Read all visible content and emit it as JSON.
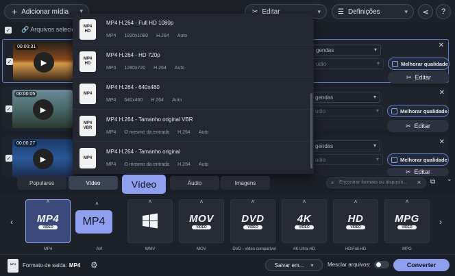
{
  "toolbar": {
    "add_media_label": "Adicionar mídia",
    "edit_label": "Editar",
    "settings_label": "Definições"
  },
  "selection": {
    "label": "Arquivos selecio"
  },
  "files": [
    {
      "duration": "00:00:31",
      "subtitles": "gendas",
      "audio": "udio",
      "enhance": "Melhorar qualidade",
      "edit": "Editar"
    },
    {
      "duration": "00:00:05",
      "subtitles": "gendas",
      "audio": "udio",
      "enhance": "Melhorar qualidade",
      "edit": "Editar"
    },
    {
      "duration": "00:00:27",
      "subtitles": "gendas",
      "audio": "udio",
      "enhance": "Melhorar qualidade",
      "edit": "Editar"
    }
  ],
  "dropdown": {
    "items": [
      {
        "icon_top": "MP4",
        "icon_bottom": "HD",
        "title": "MP4 H.264 - Full HD 1080p",
        "details": [
          "MP4",
          "1920x1080",
          "H.264",
          "Auto"
        ]
      },
      {
        "icon_top": "MP4",
        "icon_bottom": "HD",
        "title": "MP4 H.264 - HD 720p",
        "details": [
          "MP4",
          "1280x720",
          "H.264",
          "Auto"
        ]
      },
      {
        "icon_top": "MP4",
        "icon_bottom": "",
        "title": "MP4 H.264 - 640x480",
        "details": [
          "MP4",
          "640x480",
          "H.264",
          "Auto"
        ]
      },
      {
        "icon_top": "MP4",
        "icon_bottom": "VBR",
        "title": "MP4 H.264 - Tamanho original VBR",
        "details": [
          "MP4",
          "O mesmo da entrada",
          "H.264",
          "Auto"
        ]
      },
      {
        "icon_top": "MP4",
        "icon_bottom": "",
        "title": "MP4 H.264 - Tamanho original",
        "details": [
          "MP4",
          "O mesmo da entrada",
          "H.264",
          "Auto"
        ]
      }
    ]
  },
  "tabs": {
    "populares": "Populares",
    "video": "Vídeo",
    "video_tooltip": "Vídeo",
    "audio": "Áudio",
    "imagens": "Imagens"
  },
  "search": {
    "placeholder": "Encontrar formato ou dispositi..."
  },
  "formats": [
    {
      "logo": "MP4",
      "sub": "VIDEO",
      "label": "MP4"
    },
    {
      "logo": "",
      "sub": "",
      "label": "AVI"
    },
    {
      "logo": "",
      "sub": "",
      "label": "WMV"
    },
    {
      "logo": "MOV",
      "sub": "VIDEO",
      "label": "MOV"
    },
    {
      "logo": "DVD",
      "sub": "VIDEO",
      "label": "DVD - vídeo compatível"
    },
    {
      "logo": "4K",
      "sub": "VIDEO",
      "label": "4K Ultra HD"
    },
    {
      "logo": "HD",
      "sub": "VIDEO",
      "label": "HD/Full HD"
    },
    {
      "logo": "MPG",
      "sub": "VIDEO",
      "label": "MPG"
    }
  ],
  "format_tooltip": "MP4",
  "bottom": {
    "output_label": "Formato de saída:",
    "output_value": "MP4",
    "save_label": "Salvar em...",
    "merge_label": "Mesclar arquivos:",
    "convert_label": "Converter",
    "merge_enabled": false
  }
}
